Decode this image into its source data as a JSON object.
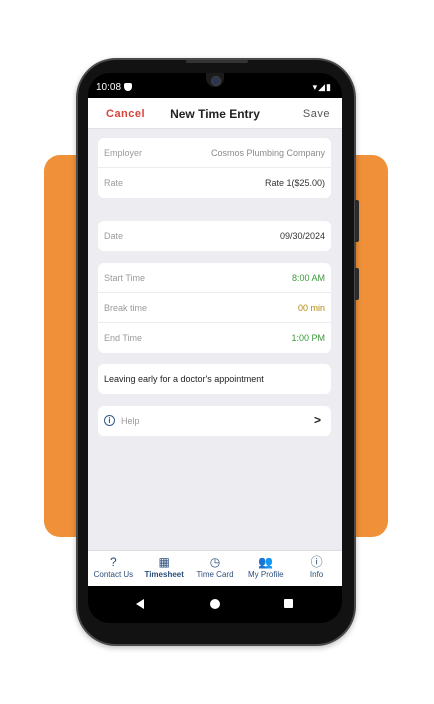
{
  "status": {
    "time": "10:08",
    "icons": "▾◢▮"
  },
  "navbar": {
    "cancel": "Cancel",
    "title": "New Time Entry",
    "save": "Save"
  },
  "employer": {
    "label": "Employer",
    "value": "Cosmos Plumbing Company"
  },
  "rate": {
    "label": "Rate",
    "value": "Rate  1($25.00)"
  },
  "date": {
    "label": "Date",
    "value": "09/30/2024"
  },
  "start_time": {
    "label": "Start Time",
    "value": "8:00 AM"
  },
  "break_time": {
    "label": "Break time",
    "value": "00 min"
  },
  "end_time": {
    "label": "End Time",
    "value": "1:00 PM"
  },
  "note": "Leaving early for a doctor's appointment",
  "help": {
    "label": "Help",
    "chevron": ">"
  },
  "tabs": [
    {
      "label": "Contact Us",
      "icon": "?"
    },
    {
      "label": "Timesheet",
      "icon": "▦"
    },
    {
      "label": "Time Card",
      "icon": "◷"
    },
    {
      "label": "My Profile",
      "icon": "👥"
    },
    {
      "label": "Info",
      "icon": "ⓘ"
    }
  ],
  "colors": {
    "accent_orange": "#f09038",
    "cancel_red": "#d9433c",
    "tab_blue": "#2c4f7c",
    "time_green": "#3a9a3a",
    "break_olive": "#b08a0a"
  }
}
